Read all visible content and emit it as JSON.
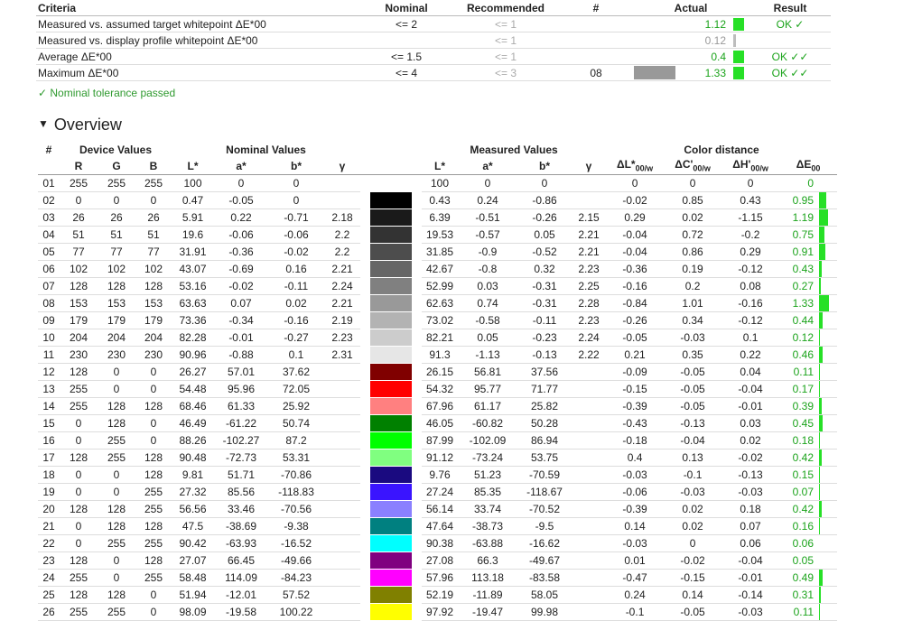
{
  "criteria": {
    "headers": {
      "criteria": "Criteria",
      "nominal": "Nominal",
      "recommended": "Recommended",
      "num": "#",
      "actual": "Actual",
      "result": "Result"
    },
    "rows": [
      {
        "name": "Measured vs. assumed target whitepoint ΔE*00",
        "nominal": "<= 2",
        "recommended": "<= 1",
        "num": "",
        "actual": "1.12",
        "actual_level": 0.55,
        "result": "OK ✓",
        "status": "ok"
      },
      {
        "name": "Measured vs. display profile whitepoint ΔE*00",
        "nominal": "",
        "recommended": "<= 1",
        "num": "",
        "actual": "0.12",
        "actual_level": 0.06,
        "result": "",
        "status": "info"
      },
      {
        "name": "Average ΔE*00",
        "nominal": "<= 1.5",
        "recommended": "<= 1",
        "num": "",
        "actual": "0.4",
        "actual_level": 0.0,
        "result": "OK ✓✓",
        "status": "ok"
      },
      {
        "name": "Maximum ΔE*00",
        "nominal": "<= 4",
        "recommended": "<= 3",
        "num": "08",
        "actual": "1.33",
        "actual_level": 0.62,
        "result": "OK ✓✓",
        "status": "ok",
        "swatch": "#999999"
      }
    ]
  },
  "nominal_passed": "✓ Nominal tolerance passed",
  "overview": {
    "triangle": "▼",
    "title": "Overview"
  },
  "table": {
    "group_headers": {
      "num": "#",
      "device": "Device Values",
      "nominal": "Nominal Values",
      "measured": "Measured Values",
      "distance": "Color distance"
    },
    "sub_headers": {
      "R": "R",
      "G": "G",
      "B": "B",
      "nL": "L*",
      "na": "a*",
      "nb": "b*",
      "ng": "γ",
      "mL": "L*",
      "ma": "a*",
      "mb": "b*",
      "mg": "γ",
      "dL": "ΔL*",
      "dC": "ΔC'",
      "dH": "ΔH'",
      "dE": "ΔE",
      "sub00w": "00/w",
      "sub00": "00"
    },
    "rows": [
      {
        "id": "01",
        "r": "255",
        "g": "255",
        "b": "255",
        "nl": "100",
        "na": "0",
        "nb": "0",
        "ng": "",
        "color": "#ffffff",
        "ml": "100",
        "ma": "0",
        "mb": "0",
        "mg": "",
        "dl": "0",
        "dc": "0",
        "dh": "0",
        "de": "0"
      },
      {
        "id": "02",
        "r": "0",
        "g": "0",
        "b": "0",
        "nl": "0.47",
        "na": "-0.05",
        "nb": "0",
        "ng": "",
        "color": "#000000",
        "ml": "0.43",
        "ma": "0.24",
        "mb": "-0.86",
        "mg": "",
        "dl": "-0.02",
        "dc": "0.85",
        "dh": "0.43",
        "de": "0.95"
      },
      {
        "id": "03",
        "r": "26",
        "g": "26",
        "b": "26",
        "nl": "5.91",
        "na": "0.22",
        "nb": "-0.71",
        "ng": "2.18",
        "color": "#1a1a1a",
        "ml": "6.39",
        "ma": "-0.51",
        "mb": "-0.26",
        "mg": "2.15",
        "dl": "0.29",
        "dc": "0.02",
        "dh": "-1.15",
        "de": "1.19"
      },
      {
        "id": "04",
        "r": "51",
        "g": "51",
        "b": "51",
        "nl": "19.6",
        "na": "-0.06",
        "nb": "-0.06",
        "ng": "2.2",
        "color": "#333333",
        "ml": "19.53",
        "ma": "-0.57",
        "mb": "0.05",
        "mg": "2.21",
        "dl": "-0.04",
        "dc": "0.72",
        "dh": "-0.2",
        "de": "0.75"
      },
      {
        "id": "05",
        "r": "77",
        "g": "77",
        "b": "77",
        "nl": "31.91",
        "na": "-0.36",
        "nb": "-0.02",
        "ng": "2.2",
        "color": "#4d4d4d",
        "ml": "31.85",
        "ma": "-0.9",
        "mb": "-0.52",
        "mg": "2.21",
        "dl": "-0.04",
        "dc": "0.86",
        "dh": "0.29",
        "de": "0.91"
      },
      {
        "id": "06",
        "r": "102",
        "g": "102",
        "b": "102",
        "nl": "43.07",
        "na": "-0.69",
        "nb": "0.16",
        "ng": "2.21",
        "color": "#666666",
        "ml": "42.67",
        "ma": "-0.8",
        "mb": "0.32",
        "mg": "2.23",
        "dl": "-0.36",
        "dc": "0.19",
        "dh": "-0.12",
        "de": "0.43"
      },
      {
        "id": "07",
        "r": "128",
        "g": "128",
        "b": "128",
        "nl": "53.16",
        "na": "-0.02",
        "nb": "-0.11",
        "ng": "2.24",
        "color": "#808080",
        "ml": "52.99",
        "ma": "0.03",
        "mb": "-0.31",
        "mg": "2.25",
        "dl": "-0.16",
        "dc": "0.2",
        "dh": "0.08",
        "de": "0.27"
      },
      {
        "id": "08",
        "r": "153",
        "g": "153",
        "b": "153",
        "nl": "63.63",
        "na": "0.07",
        "nb": "0.02",
        "ng": "2.21",
        "color": "#999999",
        "ml": "62.63",
        "ma": "0.74",
        "mb": "-0.31",
        "mg": "2.28",
        "dl": "-0.84",
        "dc": "1.01",
        "dh": "-0.16",
        "de": "1.33"
      },
      {
        "id": "09",
        "r": "179",
        "g": "179",
        "b": "179",
        "nl": "73.36",
        "na": "-0.34",
        "nb": "-0.16",
        "ng": "2.19",
        "color": "#b3b3b3",
        "ml": "73.02",
        "ma": "-0.58",
        "mb": "-0.11",
        "mg": "2.23",
        "dl": "-0.26",
        "dc": "0.34",
        "dh": "-0.12",
        "de": "0.44"
      },
      {
        "id": "10",
        "r": "204",
        "g": "204",
        "b": "204",
        "nl": "82.28",
        "na": "-0.01",
        "nb": "-0.27",
        "ng": "2.23",
        "color": "#cccccc",
        "ml": "82.21",
        "ma": "0.05",
        "mb": "-0.23",
        "mg": "2.24",
        "dl": "-0.05",
        "dc": "-0.03",
        "dh": "0.1",
        "de": "0.12"
      },
      {
        "id": "11",
        "r": "230",
        "g": "230",
        "b": "230",
        "nl": "90.96",
        "na": "-0.88",
        "nb": "0.1",
        "ng": "2.31",
        "color": "#e6e6e6",
        "ml": "91.3",
        "ma": "-1.13",
        "mb": "-0.13",
        "mg": "2.22",
        "dl": "0.21",
        "dc": "0.35",
        "dh": "0.22",
        "de": "0.46"
      },
      {
        "id": "12",
        "r": "128",
        "g": "0",
        "b": "0",
        "nl": "26.27",
        "na": "57.01",
        "nb": "37.62",
        "ng": "",
        "color": "#800000",
        "ml": "26.15",
        "ma": "56.81",
        "mb": "37.56",
        "mg": "",
        "dl": "-0.09",
        "dc": "-0.05",
        "dh": "0.04",
        "de": "0.11"
      },
      {
        "id": "13",
        "r": "255",
        "g": "0",
        "b": "0",
        "nl": "54.48",
        "na": "95.96",
        "nb": "72.05",
        "ng": "",
        "color": "#ff0000",
        "ml": "54.32",
        "ma": "95.77",
        "mb": "71.77",
        "mg": "",
        "dl": "-0.15",
        "dc": "-0.05",
        "dh": "-0.04",
        "de": "0.17"
      },
      {
        "id": "14",
        "r": "255",
        "g": "128",
        "b": "128",
        "nl": "68.46",
        "na": "61.33",
        "nb": "25.92",
        "ng": "",
        "color": "#ff8080",
        "ml": "67.96",
        "ma": "61.17",
        "mb": "25.82",
        "mg": "",
        "dl": "-0.39",
        "dc": "-0.05",
        "dh": "-0.01",
        "de": "0.39"
      },
      {
        "id": "15",
        "r": "0",
        "g": "128",
        "b": "0",
        "nl": "46.49",
        "na": "-61.22",
        "nb": "50.74",
        "ng": "",
        "color": "#008000",
        "ml": "46.05",
        "ma": "-60.82",
        "mb": "50.28",
        "mg": "",
        "dl": "-0.43",
        "dc": "-0.13",
        "dh": "0.03",
        "de": "0.45"
      },
      {
        "id": "16",
        "r": "0",
        "g": "255",
        "b": "0",
        "nl": "88.26",
        "na": "-102.27",
        "nb": "87.2",
        "ng": "",
        "color": "#00ff00",
        "ml": "87.99",
        "ma": "-102.09",
        "mb": "86.94",
        "mg": "",
        "dl": "-0.18",
        "dc": "-0.04",
        "dh": "0.02",
        "de": "0.18"
      },
      {
        "id": "17",
        "r": "128",
        "g": "255",
        "b": "128",
        "nl": "90.48",
        "na": "-72.73",
        "nb": "53.31",
        "ng": "",
        "color": "#80ff80",
        "ml": "91.12",
        "ma": "-73.24",
        "mb": "53.75",
        "mg": "",
        "dl": "0.4",
        "dc": "0.13",
        "dh": "-0.02",
        "de": "0.42"
      },
      {
        "id": "18",
        "r": "0",
        "g": "0",
        "b": "128",
        "nl": "9.81",
        "na": "51.71",
        "nb": "-70.86",
        "ng": "",
        "color": "#1a0a80",
        "ml": "9.76",
        "ma": "51.23",
        "mb": "-70.59",
        "mg": "",
        "dl": "-0.03",
        "dc": "-0.1",
        "dh": "-0.13",
        "de": "0.15"
      },
      {
        "id": "19",
        "r": "0",
        "g": "0",
        "b": "255",
        "nl": "27.32",
        "na": "85.56",
        "nb": "-118.83",
        "ng": "",
        "color": "#3a14ff",
        "ml": "27.24",
        "ma": "85.35",
        "mb": "-118.67",
        "mg": "",
        "dl": "-0.06",
        "dc": "-0.03",
        "dh": "-0.03",
        "de": "0.07"
      },
      {
        "id": "20",
        "r": "128",
        "g": "128",
        "b": "255",
        "nl": "56.56",
        "na": "33.46",
        "nb": "-70.56",
        "ng": "",
        "color": "#8a80ff",
        "ml": "56.14",
        "ma": "33.74",
        "mb": "-70.52",
        "mg": "",
        "dl": "-0.39",
        "dc": "0.02",
        "dh": "0.18",
        "de": "0.42"
      },
      {
        "id": "21",
        "r": "0",
        "g": "128",
        "b": "128",
        "nl": "47.5",
        "na": "-38.69",
        "nb": "-9.38",
        "ng": "",
        "color": "#008080",
        "ml": "47.64",
        "ma": "-38.73",
        "mb": "-9.5",
        "mg": "",
        "dl": "0.14",
        "dc": "0.02",
        "dh": "0.07",
        "de": "0.16"
      },
      {
        "id": "22",
        "r": "0",
        "g": "255",
        "b": "255",
        "nl": "90.42",
        "na": "-63.93",
        "nb": "-16.52",
        "ng": "",
        "color": "#00ffff",
        "ml": "90.38",
        "ma": "-63.88",
        "mb": "-16.62",
        "mg": "",
        "dl": "-0.03",
        "dc": "0",
        "dh": "0.06",
        "de": "0.06"
      },
      {
        "id": "23",
        "r": "128",
        "g": "0",
        "b": "128",
        "nl": "27.07",
        "na": "66.45",
        "nb": "-49.66",
        "ng": "",
        "color": "#800080",
        "ml": "27.08",
        "ma": "66.3",
        "mb": "-49.67",
        "mg": "",
        "dl": "0.01",
        "dc": "-0.02",
        "dh": "-0.04",
        "de": "0.05"
      },
      {
        "id": "24",
        "r": "255",
        "g": "0",
        "b": "255",
        "nl": "58.48",
        "na": "114.09",
        "nb": "-84.23",
        "ng": "",
        "color": "#ff00ff",
        "ml": "57.96",
        "ma": "113.18",
        "mb": "-83.58",
        "mg": "",
        "dl": "-0.47",
        "dc": "-0.15",
        "dh": "-0.01",
        "de": "0.49"
      },
      {
        "id": "25",
        "r": "128",
        "g": "128",
        "b": "0",
        "nl": "51.94",
        "na": "-12.01",
        "nb": "57.52",
        "ng": "",
        "color": "#808000",
        "ml": "52.19",
        "ma": "-11.89",
        "mb": "58.05",
        "mg": "",
        "dl": "0.24",
        "dc": "0.14",
        "dh": "-0.14",
        "de": "0.31"
      },
      {
        "id": "26",
        "r": "255",
        "g": "255",
        "b": "0",
        "nl": "98.09",
        "na": "-19.58",
        "nb": "100.22",
        "ng": "",
        "color": "#ffff00",
        "ml": "97.92",
        "ma": "-19.47",
        "mb": "99.98",
        "mg": "",
        "dl": "-0.1",
        "dc": "-0.05",
        "dh": "-0.03",
        "de": "0.11"
      }
    ]
  },
  "colors": {
    "ok": "#1ba31b",
    "bar": "#27e027",
    "grey_bar": "#bdbdbd"
  }
}
